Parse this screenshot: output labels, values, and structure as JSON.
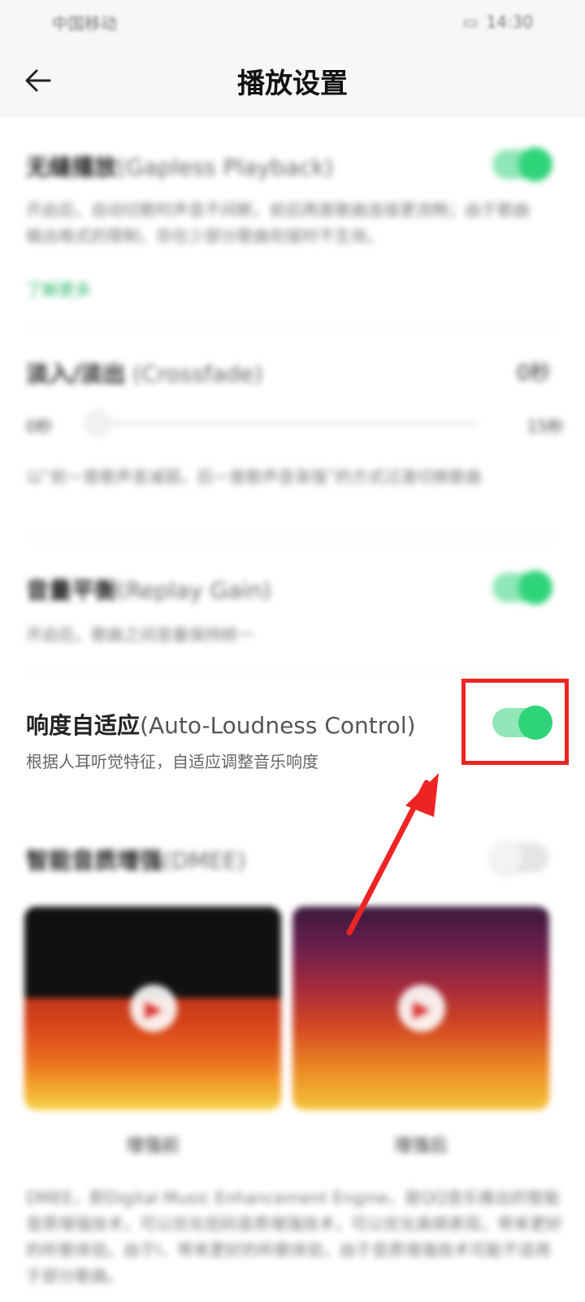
{
  "status_bar": {
    "carrier": "中国移动",
    "time": "14:30"
  },
  "header": {
    "title": "播放设置",
    "back_icon": "arrow-left-icon"
  },
  "gapless": {
    "title_cn": "无缝播放",
    "title_en": "(Gapless Playback)",
    "description": "开启后，自动切歌时声音不间断，前后两首歌曲连接更流畅；由于歌曲输出格式的限制，存在少部分歌曲衔接时不生效。",
    "link": "了解更多",
    "enabled": true
  },
  "crossfade": {
    "title_cn": "淡入/淡出",
    "title_en": " (Crossfade)",
    "value": "0秒",
    "min_label": "0秒",
    "max_label": "15秒",
    "slider_value": 0,
    "description": "以“前一首歌声音减弱，后一首歌声音渐强”的方式过渡切换歌曲"
  },
  "replay_gain": {
    "title_cn": "音量平衡",
    "title_en": "(Replay Gain)",
    "description": "开启后，歌曲之间音量保持统一",
    "enabled": true
  },
  "auto_loudness": {
    "title_cn": "响度自适应",
    "title_en": "(Auto-Loudness Control)",
    "description": "根据人耳听觉特征，自适应调整音乐响度",
    "enabled": true
  },
  "dmee": {
    "title_cn": "智能音质增强",
    "title_en": "(DMEE)",
    "enabled": false,
    "before_label": "增强前",
    "after_label": "增强后",
    "description": "DMEE，即Digital Music Enhancement Engine，是QQ音乐推出的智能音质增强技术，可以优化低码音质增强技术，可以优化高频表现，带来更好的听歌体验。由于I，带来更好的听歌体验，由于音质增强技术可能不适用于部分歌曲。"
  },
  "colors": {
    "accent_green": "#2fd479",
    "highlight_red": "#ee2424"
  }
}
